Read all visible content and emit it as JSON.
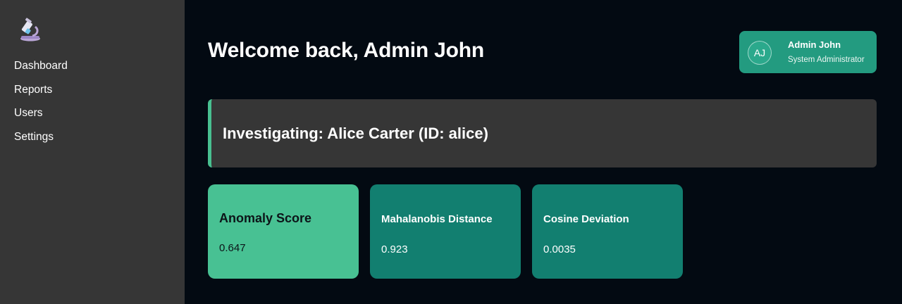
{
  "sidebar": {
    "logo_icon": "microscope-icon",
    "items": [
      {
        "label": "Dashboard"
      },
      {
        "label": "Reports"
      },
      {
        "label": "Users"
      },
      {
        "label": "Settings"
      }
    ]
  },
  "header": {
    "welcome": "Welcome back, Admin John"
  },
  "user": {
    "initials": "AJ",
    "name": "Admin John",
    "role": "System Administrator"
  },
  "banner": {
    "text": "Investigating: Alice Carter (ID: alice)"
  },
  "metrics": [
    {
      "title": "Anomaly Score",
      "value": "0.647"
    },
    {
      "title": "Mahalanobis Distance",
      "value": "0.923"
    },
    {
      "title": "Cosine Deviation",
      "value": "0.0035"
    }
  ],
  "colors": {
    "background": "#030a12",
    "sidebar": "#363636",
    "accent": "#239b80",
    "card_primary": "#48c193",
    "card_secondary": "#127f70"
  }
}
